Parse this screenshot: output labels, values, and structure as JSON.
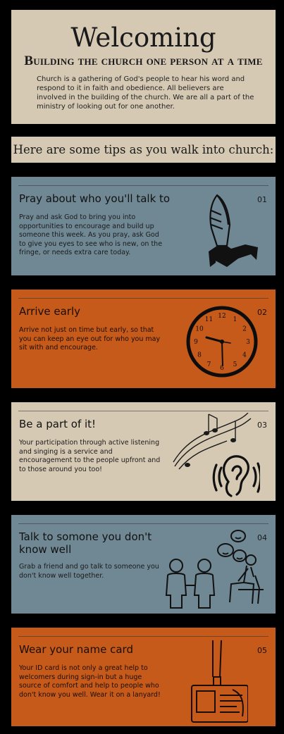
{
  "hero": {
    "title": "Welcoming",
    "subtitle": "Building the church one person at a time",
    "body": "Church is a gathering of God's people to hear his word and respond to it in faith and obedience. All believers are involved in the building of the church. We are all a part of the ministry of looking out for one another."
  },
  "tips_heading": "Here are some tips as you walk into church:",
  "cards": [
    {
      "number": "01",
      "title": "Pray about who you'll talk to",
      "body": "Pray and ask God to bring you into opportunities to encourage and build up someone this week. As you pray, ask God to give you eyes to see who is new, on the fringe, or needs extra care today.",
      "icon": "praying-hands-icon"
    },
    {
      "number": "02",
      "title": "Arrive early",
      "body": "Arrive not just on time but early, so that you can keep an eye out for who you may sit with and encourage.",
      "icon": "clock-icon"
    },
    {
      "number": "03",
      "title": "Be a part of it!",
      "body": "Your participation through active listening and singing is a service and encouragement to the people upfront and to those around you too!",
      "icon": "ear-music-icon"
    },
    {
      "number": "04",
      "title": "Talk to somone you don't know well",
      "body": "Grab a friend and go talk to someone you don't know well together.",
      "icon": "people-talking-icon"
    },
    {
      "number": "05",
      "title": "Wear your name card",
      "body": "Your ID card is not only a great help to welcomers during sign-in but a huge source of comfort and help to people who don't know you well. Wear it on a lanyard!",
      "icon": "id-card-lanyard-icon"
    }
  ],
  "clock_numbers": [
    "12",
    "1",
    "2",
    "3",
    "4",
    "5",
    "6",
    "7",
    "8",
    "9",
    "10",
    "11"
  ]
}
